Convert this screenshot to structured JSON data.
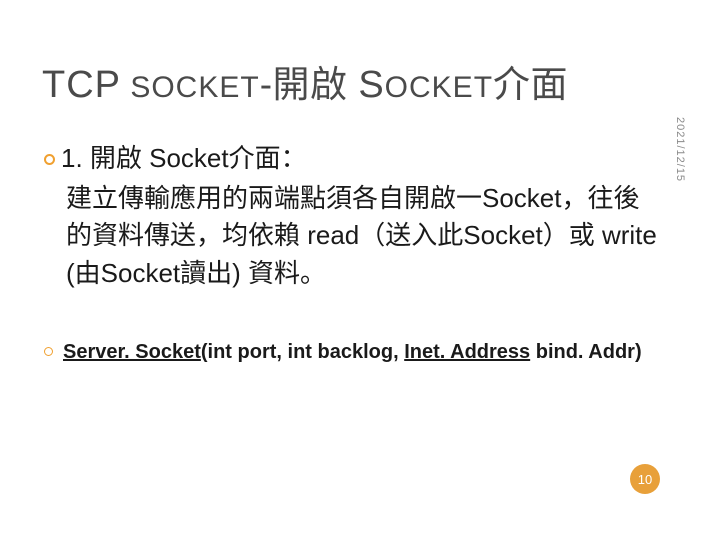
{
  "title": {
    "tcp": "TCP",
    "socket_small": " SOCKET",
    "dash": "-",
    "cjk1": "開啟 ",
    "s_big": "S",
    "ocket_small": "OCKET",
    "cjk2": "介面"
  },
  "date": "2021/12/15",
  "body": {
    "item1_lead": "1. 開啟 Socket介面：",
    "item1_desc": "建立傳輸應用的兩端點須各自開啟一Socket，往後的資料傳送，均依賴 read（送入此Socket）或 write (由Socket讀出) 資料。",
    "item2_class1": "Server. Socket",
    "item2_open": "(int port, int backlog, ",
    "item2_class2": "Inet. Address",
    "item2_rest": " bind. Addr)"
  },
  "page_number": "10"
}
